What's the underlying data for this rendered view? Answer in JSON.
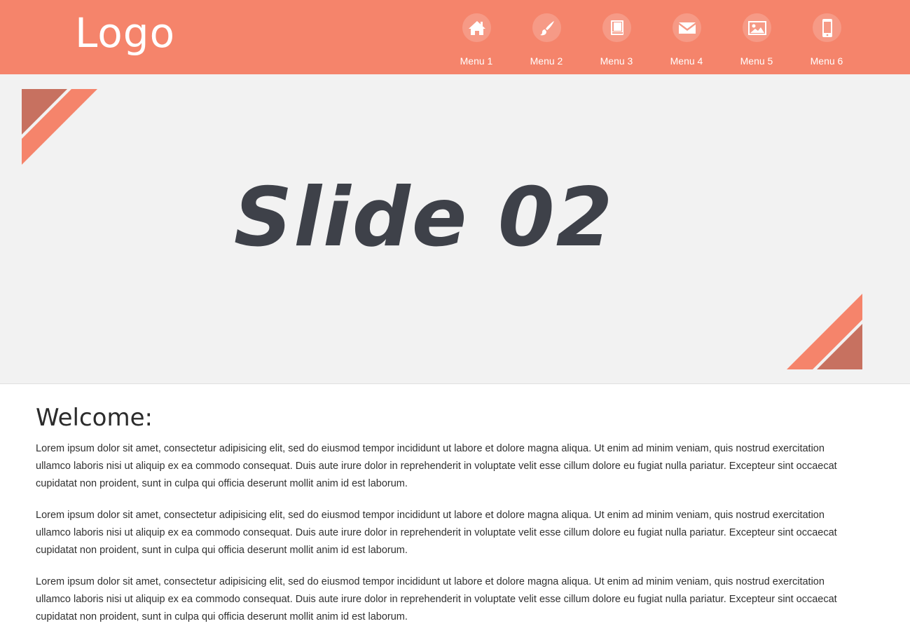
{
  "header": {
    "logo_text": "Logo",
    "background_color": "#f5846b"
  },
  "nav": {
    "items": [
      {
        "label": "Menu 1",
        "icon": "home-icon"
      },
      {
        "label": "Menu 2",
        "icon": "paintbrush-icon"
      },
      {
        "label": "Menu 3",
        "icon": "book-icon"
      },
      {
        "label": "Menu 4",
        "icon": "envelope-icon"
      },
      {
        "label": "Menu 5",
        "icon": "image-icon"
      },
      {
        "label": "Menu 6",
        "icon": "mobile-phone-icon"
      }
    ]
  },
  "slider": {
    "title": "Slide 02",
    "background_color": "#f2f2f2",
    "ribbon_colors": [
      "#c77160",
      "#f5846b"
    ]
  },
  "content": {
    "heading": "Welcome:",
    "paragraphs": [
      "Lorem ipsum dolor sit amet, consectetur adipisicing elit, sed do eiusmod tempor incididunt ut labore et dolore magna aliqua. Ut enim ad minim veniam, quis nostrud exercitation ullamco laboris nisi ut aliquip ex ea commodo consequat. Duis aute irure dolor in reprehenderit in voluptate velit esse cillum dolore eu fugiat nulla pariatur. Excepteur sint occaecat cupidatat non proident, sunt in culpa qui officia deserunt mollit anim id est laborum.",
      "Lorem ipsum dolor sit amet, consectetur adipisicing elit, sed do eiusmod tempor incididunt ut labore et dolore magna aliqua. Ut enim ad minim veniam, quis nostrud exercitation ullamco laboris nisi ut aliquip ex ea commodo consequat. Duis aute irure dolor in reprehenderit in voluptate velit esse cillum dolore eu fugiat nulla pariatur. Excepteur sint occaecat cupidatat non proident, sunt in culpa qui officia deserunt mollit anim id est laborum.",
      "Lorem ipsum dolor sit amet, consectetur adipisicing elit, sed do eiusmod tempor incididunt ut labore et dolore magna aliqua. Ut enim ad minim veniam, quis nostrud exercitation ullamco laboris nisi ut aliquip ex ea commodo consequat. Duis aute irure dolor in reprehenderit in voluptate velit esse cillum dolore eu fugiat nulla pariatur. Excepteur sint occaecat cupidatat non proident, sunt in culpa qui officia deserunt mollit anim id est laborum."
    ]
  }
}
